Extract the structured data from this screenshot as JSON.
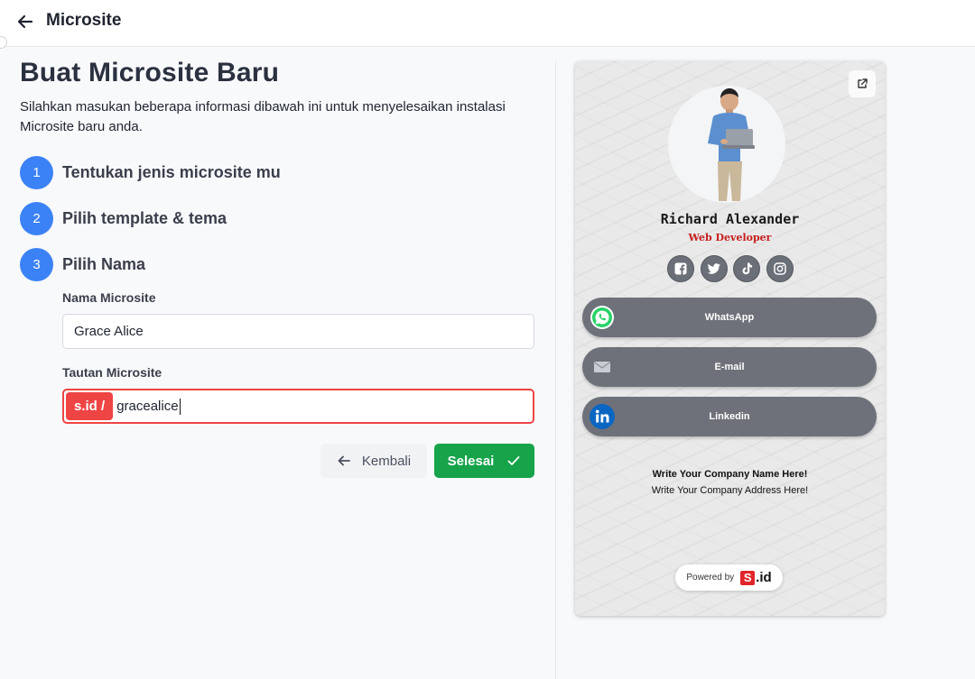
{
  "header": {
    "title": "Microsite"
  },
  "main": {
    "title": "Buat Microsite Baru",
    "description": "Silahkan masukan beberapa informasi dibawah ini untuk menyelesaikan instalasi Microsite baru anda.",
    "steps": [
      {
        "number": "1",
        "label": "Tentukan jenis microsite mu"
      },
      {
        "number": "2",
        "label": "Pilih template & tema"
      },
      {
        "number": "3",
        "label": "Pilih Nama"
      }
    ],
    "form": {
      "name_label": "Nama Microsite",
      "name_value": "Grace Alice",
      "link_label": "Tautan Microsite",
      "link_prefix": "s.id /",
      "link_value": "gracealice"
    },
    "buttons": {
      "back": "Kembali",
      "done": "Selesai"
    }
  },
  "preview": {
    "name": "Richard Alexander",
    "role": "Web Developer",
    "socials": [
      "facebook-icon",
      "twitter-icon",
      "tiktok-icon",
      "instagram-icon"
    ],
    "links": [
      {
        "label": "WhatsApp",
        "icon": "whatsapp-icon"
      },
      {
        "label": "E-mail",
        "icon": "email-icon"
      },
      {
        "label": "Linkedin",
        "icon": "linkedin-icon"
      }
    ],
    "company_name": "Write Your Company Name Here!",
    "company_address": "Write Your Company Address Here!",
    "powered_by": "Powered by",
    "brand": "S.id"
  },
  "colors": {
    "primary": "#3b82f6",
    "success": "#16a34a",
    "error": "#ef4444",
    "role_text": "#c81e1e"
  }
}
